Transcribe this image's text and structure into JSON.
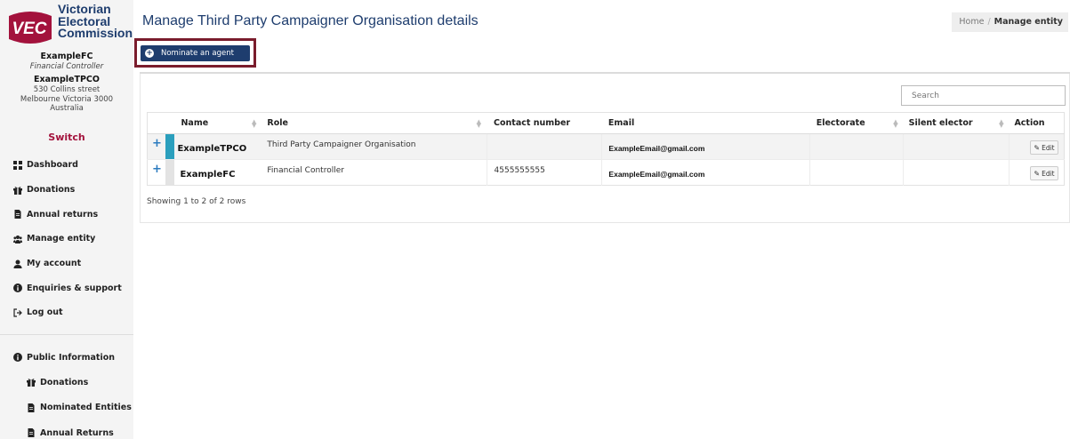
{
  "sidebar": {
    "logo": {
      "badge": "VEC",
      "line1": "Victorian",
      "line2": "Electoral",
      "line3": "Commission"
    },
    "user": {
      "name": "ExampleFC",
      "role": "Financial Controller"
    },
    "org": {
      "name": "ExampleTPCO",
      "addr1": "530 Collins street",
      "addr2": "Melbourne Victoria 3000",
      "addr3": "Australia"
    },
    "switch_label": "Switch",
    "nav": [
      {
        "label": "Dashboard",
        "icon": "dashboard-icon"
      },
      {
        "label": "Donations",
        "icon": "gift-icon"
      },
      {
        "label": "Annual returns",
        "icon": "document-icon"
      },
      {
        "label": "Manage entity",
        "icon": "users-icon"
      },
      {
        "label": "My account",
        "icon": "user-icon"
      },
      {
        "label": "Enquiries & support",
        "icon": "info-icon"
      },
      {
        "label": "Log out",
        "icon": "logout-icon"
      }
    ],
    "public": {
      "title": "Public Information",
      "items": [
        {
          "label": "Donations",
          "icon": "gift-icon"
        },
        {
          "label": "Nominated Entities",
          "icon": "document-icon"
        },
        {
          "label": "Annual Returns",
          "icon": "document-icon"
        }
      ]
    }
  },
  "header": {
    "title": "Manage Third Party Campaigner Organisation details",
    "breadcrumb": {
      "home": "Home",
      "current": "Manage entity"
    }
  },
  "toolbar": {
    "nominate_label": "Nominate an agent"
  },
  "search": {
    "placeholder": "Search"
  },
  "table": {
    "columns": [
      "Name",
      "Role",
      "Contact number",
      "Email",
      "Electorate",
      "Silent elector",
      "Action"
    ],
    "rows": [
      {
        "name": "ExampleTPCO",
        "role": "Third Party Campaigner Organisation",
        "contact": "",
        "email": "ExampleEmail@gmail.com",
        "electorate": "",
        "silent": "",
        "action": "Edit"
      },
      {
        "name": "ExampleFC",
        "role": "Financial Controller",
        "contact": "4555555555",
        "email": "ExampleEmail@gmail.com",
        "electorate": "",
        "silent": "",
        "action": "Edit"
      }
    ],
    "footer": "Showing 1 to 2 of 2 rows"
  },
  "colors": {
    "brand": "#1e3d6e",
    "accent": "#a3123c",
    "highlight_border": "#7a1c2c",
    "row_stripe": "#2b9fbd"
  }
}
